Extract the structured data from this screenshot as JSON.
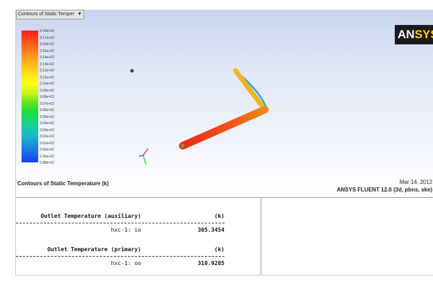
{
  "viewport": {
    "dropdown_label": "Contours of Static Temper",
    "logo_text_prefix": "AN",
    "logo_text_suffix": "SYS",
    "colorbar_labels": [
      "3.18e+02",
      "3.17e+02",
      "3.16e+02",
      "3.15e+02",
      "3.14e+02",
      "3.13e+02",
      "3.12e+02",
      "3.11e+02",
      "3.10e+02",
      "3.09e+02",
      "3.08e+02",
      "3.07e+02",
      "3.06e+02",
      "3.05e+02",
      "3.04e+02",
      "3.03e+02",
      "3.02e+02",
      "3.01e+02",
      "3.00e+02",
      "2.99e+02",
      "2.98e+02"
    ],
    "caption_title": "Contours of Static Temperature (k)",
    "caption_date": "Mar 14, 2012",
    "caption_solver": "ANSYS FLUENT 12.0 (3d, pbns, ske)",
    "colors": {
      "pipe_hot": "#ee2a1a",
      "pipe_warm": "#f08a1a",
      "pipe_mid": "#f6b41a",
      "pipe_cool": "#f2d01a",
      "bypass": "#2aa0e6",
      "axis_x": "#e01a1a",
      "axis_y": "#1ac81a",
      "axis_z": "#3a3aee"
    }
  },
  "report": {
    "blocks": [
      {
        "header_name": "Outlet Temperature (auxiliary)",
        "header_unit": "(k)",
        "row_name": "hxc-1: io",
        "row_value": "305.3454"
      },
      {
        "header_name": "Outlet Temperature (primary)",
        "header_unit": "(k)",
        "row_name": "hxc-1: oo",
        "row_value": "310.9285"
      }
    ]
  }
}
